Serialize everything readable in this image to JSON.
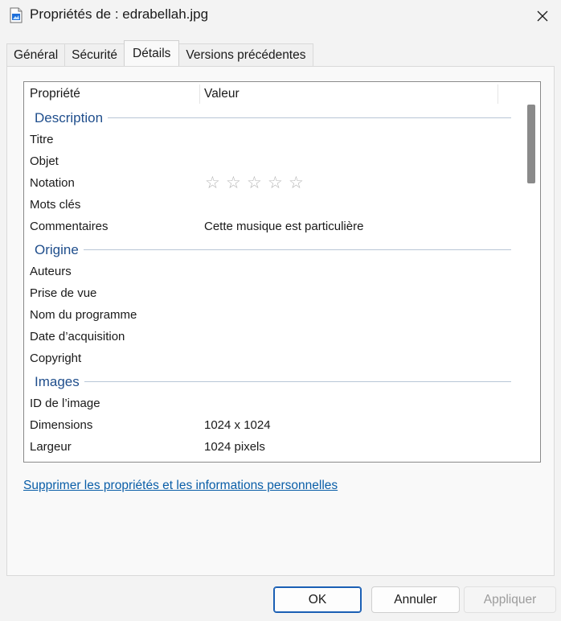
{
  "window": {
    "title": "Propriétés de : edrabellah.jpg",
    "icon": "image-file-icon",
    "close_icon": "close-icon"
  },
  "tabs": [
    {
      "label": "Général",
      "active": false
    },
    {
      "label": "Sécurité",
      "active": false
    },
    {
      "label": "Détails",
      "active": true
    },
    {
      "label": "Versions précédentes",
      "active": false
    }
  ],
  "list": {
    "col_property": "Propriété",
    "col_value": "Valeur",
    "groups": [
      {
        "label": "Description",
        "rows": [
          {
            "key": "Titre",
            "value": ""
          },
          {
            "key": "Objet",
            "value": ""
          },
          {
            "key": "Notation",
            "value": "",
            "stars": 5,
            "rating": 0
          },
          {
            "key": "Mots clés",
            "value": ""
          },
          {
            "key": "Commentaires",
            "value": "Cette musique est particulière"
          }
        ]
      },
      {
        "label": "Origine",
        "rows": [
          {
            "key": "Auteurs",
            "value": ""
          },
          {
            "key": "Prise de vue",
            "value": ""
          },
          {
            "key": "Nom du programme",
            "value": ""
          },
          {
            "key": "Date d’acquisition",
            "value": ""
          },
          {
            "key": "Copyright",
            "value": ""
          }
        ]
      },
      {
        "label": "Images",
        "rows": [
          {
            "key": "ID de l’image",
            "value": ""
          },
          {
            "key": "Dimensions",
            "value": "1024 x 1024"
          },
          {
            "key": "Largeur",
            "value": "1024 pixels"
          }
        ]
      }
    ]
  },
  "remove_link": "Supprimer les propriétés et les informations personnelles",
  "buttons": {
    "ok": "OK",
    "cancel": "Annuler",
    "apply": "Appliquer"
  },
  "colors": {
    "group_header": "#1f4e8c",
    "link": "#0a5ea8",
    "accent": "#1a5fb4"
  }
}
